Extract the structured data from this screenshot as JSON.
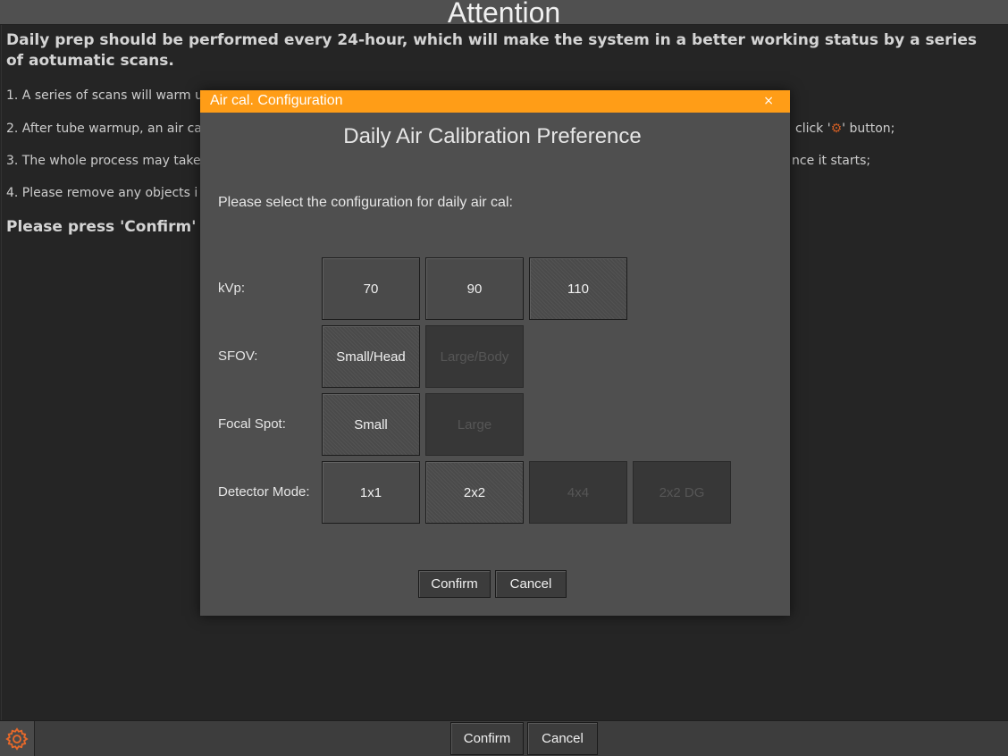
{
  "window": {
    "title": "Attention"
  },
  "main": {
    "intro": "Daily prep should be performed every 24-hour, which will make the system in a better working status by a series of aotumatic scans.",
    "steps": {
      "s1": "1. A series of scans will warm u",
      "s2a": "2. After tube warmup, an air ca",
      "s2b": "click '",
      "s2c": "' button;",
      "s3a": "3. The whole process may take",
      "s3b": "nce it starts;",
      "s4": "4. Please remove any objects i"
    },
    "press": "Please press 'Confirm' to"
  },
  "bottom": {
    "confirm_label": "Confirm",
    "cancel_label": "Cancel"
  },
  "dialog": {
    "header": "Air cal. Configuration",
    "close": "×",
    "title": "Daily Air Calibration Preference",
    "prompt": "Please select the configuration for daily air cal:",
    "rows": {
      "kvp": {
        "label": "kVp:",
        "options": [
          "70",
          "90",
          "110"
        ]
      },
      "sfov": {
        "label": "SFOV:",
        "options": [
          "Small/Head",
          "Large/Body"
        ]
      },
      "focal": {
        "label": "Focal Spot:",
        "options": [
          "Small",
          "Large"
        ]
      },
      "detector": {
        "label": "Detector Mode:",
        "options": [
          "1x1",
          "2x2",
          "4x4",
          "2x2 DG"
        ]
      }
    },
    "selected": {
      "kvp": "110",
      "sfov": "Small/Head",
      "focal": "Small",
      "detector": "2x2"
    },
    "disabled": [
      "Large/Body",
      "Large",
      "4x4",
      "2x2 DG"
    ],
    "confirm_label": "Confirm",
    "cancel_label": "Cancel"
  },
  "colors": {
    "accent": "#ff9d17",
    "icon": "#e8692a"
  },
  "icons": {
    "settings": "gear-icon",
    "close": "close-icon"
  }
}
